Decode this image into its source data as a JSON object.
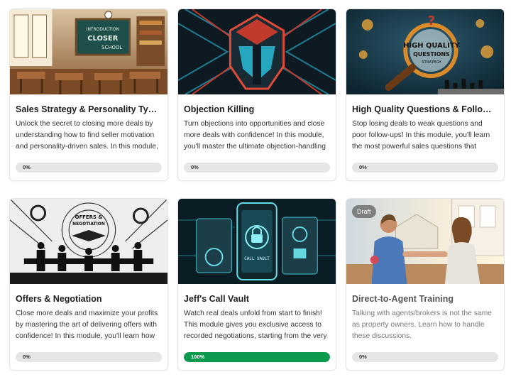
{
  "accent_color": "#0e9a4e",
  "modules": [
    {
      "title": "Sales Strategy & Personality Types",
      "description": "Unlock the secret to closing more deals by understanding how to find seller motivation and personality-driven sales. In this module,",
      "progress": 0,
      "progress_label": "0%",
      "thumbnail_text": [
        "INTRODUCTION",
        "CLOSER",
        "SCHOOL"
      ],
      "thumbnail_icon": "classroom-image"
    },
    {
      "title": "Objection Killing",
      "description": "Turn objections into opportunities and close more deals with confidence! In this module, you'll master the ultimate objection-handling",
      "progress": 0,
      "progress_label": "0%",
      "thumbnail_icon": "spartan-helmet-image"
    },
    {
      "title": "High Quality Questions & Following",
      "description": "Stop losing deals to weak questions and poor follow-ups! In this module, you'll learn the most powerful sales questions that",
      "progress": 0,
      "progress_label": "0%",
      "thumbnail_text": [
        "HIGH QUALITY",
        "QUESTIONS",
        "STRATEGY"
      ],
      "thumbnail_icon": "magnifier-chess-image"
    },
    {
      "title": "Offers & Negotiation",
      "description": "Close more deals and maximize your profits by mastering the art of delivering offers with confidence! In this module, you'll learn how",
      "progress": 0,
      "progress_label": "0%",
      "thumbnail_text": [
        "OFFERS &",
        "NEGOTIATION"
      ],
      "thumbnail_icon": "handshake-meeting-image"
    },
    {
      "title": "Jeff's Call Vault",
      "description": "Watch real deals unfold from start to finish! This module gives you exclusive access to recorded negotiations, starting from the very",
      "progress": 100,
      "progress_label": "100%",
      "thumbnail_text": [
        "CALL VAULT"
      ],
      "thumbnail_icon": "phone-vault-image"
    },
    {
      "title": "Direct-to-Agent Training",
      "description": "Talking with agents/brokers is not the same as property owners. Learn how to handle these discussions.",
      "progress": 0,
      "progress_label": "0%",
      "badge": "Draft",
      "thumbnail_icon": "agents-handshake-image"
    }
  ]
}
